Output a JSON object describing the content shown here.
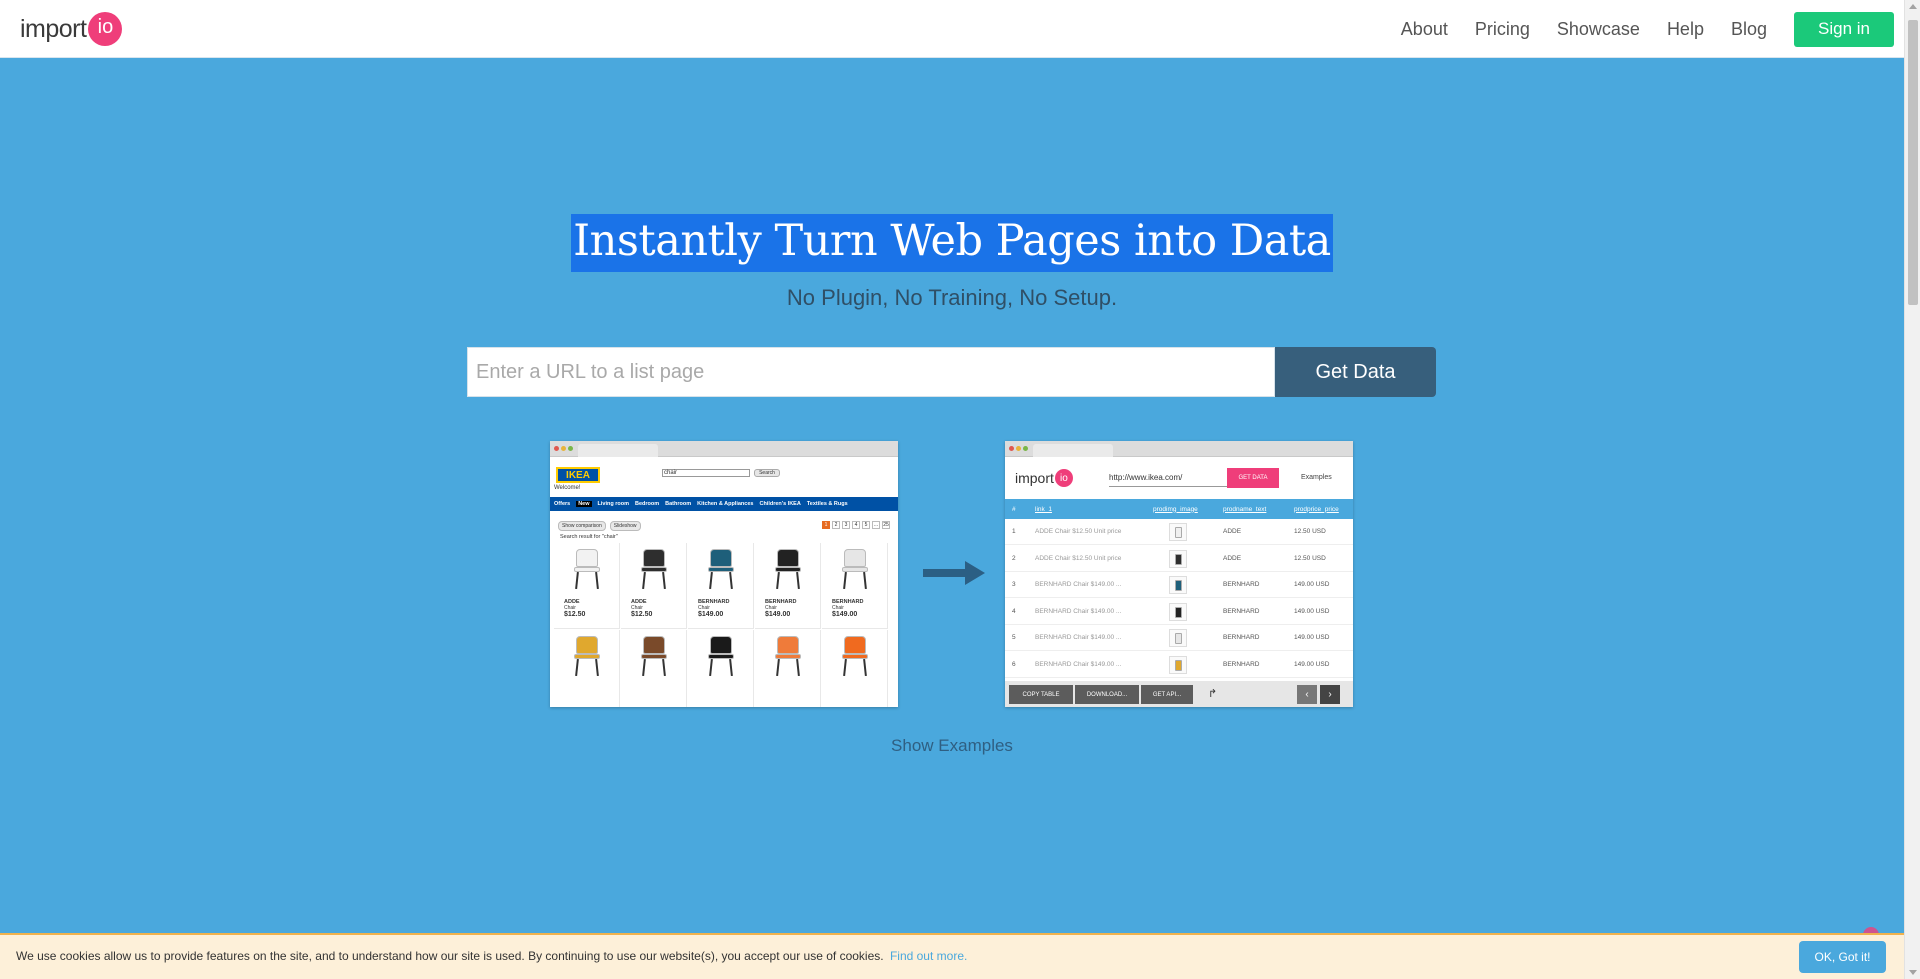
{
  "navbar": {
    "logo_text": "import",
    "logo_circle": "io",
    "links": [
      "About",
      "Pricing",
      "Showcase",
      "Help",
      "Blog"
    ],
    "signin_label": "Sign in"
  },
  "hero": {
    "title": "Instantly Turn Web Pages into Data",
    "subtitle": "No Plugin, No Training, No Setup.",
    "url_placeholder": "Enter a URL to a list page",
    "get_data_label": "Get Data"
  },
  "ikea_mock": {
    "logo": "IKEA",
    "welcome": "Welcome!",
    "search_value": "chair",
    "search_btn": "Search",
    "nav": [
      "Offers",
      "New",
      "Living room",
      "Bedroom",
      "Bathroom",
      "Kitchen & Appliances",
      "Children's IKEA",
      "Textiles & Rugs"
    ],
    "controls": [
      "Show comparison",
      "Slideshow"
    ],
    "pages": [
      "1",
      "2",
      "3",
      "4",
      "5",
      "...",
      "25"
    ],
    "result_text": "Search result for \"chair\"",
    "products": [
      {
        "name": "ADDE",
        "type": "Chair",
        "price": "$12.50",
        "color": "#f2f2f2"
      },
      {
        "name": "ADDE",
        "type": "Chair",
        "price": "$12.50",
        "color": "#2e2e2e"
      },
      {
        "name": "BERNHARD",
        "type": "Chair",
        "price": "$149.00",
        "color": "#1e5f7a"
      },
      {
        "name": "BERNHARD",
        "type": "Chair",
        "price": "$149.00",
        "color": "#222222"
      },
      {
        "name": "BERNHARD",
        "type": "Chair",
        "price": "$149.00",
        "color": "#e6e6e6"
      },
      {
        "name": "",
        "type": "",
        "price": "",
        "color": "#e0a82e"
      },
      {
        "name": "",
        "type": "",
        "price": "",
        "color": "#7a4a2a"
      },
      {
        "name": "",
        "type": "",
        "price": "",
        "color": "#1a1a1a"
      },
      {
        "name": "",
        "type": "",
        "price": "",
        "color": "#ef7b3a"
      },
      {
        "name": "",
        "type": "",
        "price": "",
        "color": "#f06a1f"
      }
    ]
  },
  "app_mock": {
    "logo_text": "import",
    "logo_circle": "io",
    "url": "http://www.ikea.com/",
    "get_data": "GET DATA",
    "examples": "Examples",
    "headers": [
      "#",
      "link_1",
      "prodimg_image",
      "prodname_text",
      "prodprice_price"
    ],
    "rows": [
      {
        "n": "1",
        "link": "ADDE Chair $12.50 Unit price",
        "name": "ADDE",
        "price": "12.50 USD",
        "color": "#f0f0f0"
      },
      {
        "n": "2",
        "link": "ADDE Chair $12.50 Unit price",
        "name": "ADDE",
        "price": "12.50 USD",
        "color": "#2e2e2e"
      },
      {
        "n": "3",
        "link": "BERNHARD Chair $149.00 ...",
        "name": "BERNHARD",
        "price": "149.00 USD",
        "color": "#1e5f7a"
      },
      {
        "n": "4",
        "link": "BERNHARD Chair $149.00 ...",
        "name": "BERNHARD",
        "price": "149.00 USD",
        "color": "#222222"
      },
      {
        "n": "5",
        "link": "BERNHARD Chair $149.00 ...",
        "name": "BERNHARD",
        "price": "149.00 USD",
        "color": "#e6e6e6"
      },
      {
        "n": "6",
        "link": "BERNHARD Chair $149.00 ...",
        "name": "BERNHARD",
        "price": "149.00 USD",
        "color": "#e0a82e"
      }
    ],
    "footer_buttons": [
      "COPY TABLE",
      "DOWNLOAD...",
      "GET API..."
    ],
    "prev": "‹",
    "next": "›"
  },
  "show_examples": "Show Examples",
  "cookie": {
    "text": "We use cookies allow us to provide features on the site, and to understand how our site is used. By continuing to use our website(s), you accept our use of cookies.",
    "link": "Find out more.",
    "ok": "OK, Got it!"
  },
  "colors": {
    "background": "#4aa8dd",
    "brand_pink": "#ef3e7a",
    "signin_green": "#1bc97a",
    "button_dark": "#375f7c"
  }
}
